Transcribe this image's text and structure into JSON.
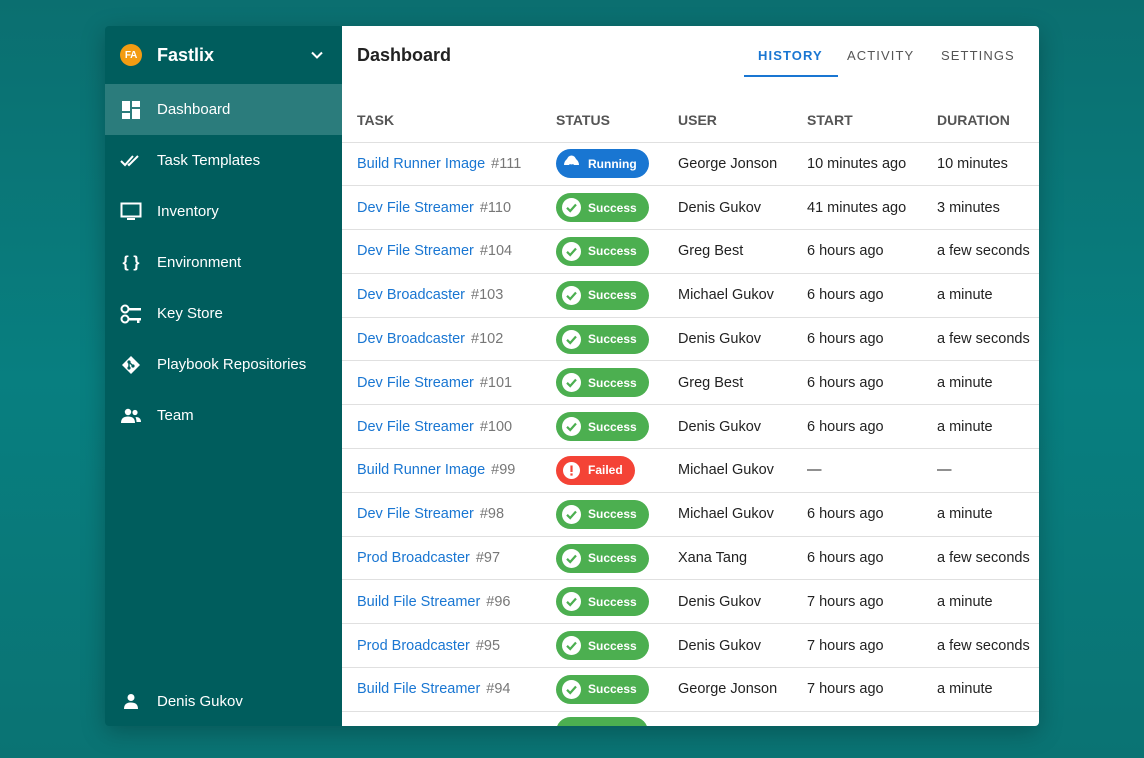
{
  "brand": {
    "initials": "FA",
    "name": "Fastlix"
  },
  "sidebar": {
    "items": [
      {
        "label": "Dashboard",
        "icon": "dashboard-icon",
        "active": true
      },
      {
        "label": "Task Templates",
        "icon": "done-all-icon"
      },
      {
        "label": "Inventory",
        "icon": "monitor-icon"
      },
      {
        "label": "Environment",
        "icon": "braces-icon"
      },
      {
        "label": "Key Store",
        "icon": "key-icon"
      },
      {
        "label": "Playbook Repositories",
        "icon": "git-icon"
      },
      {
        "label": "Team",
        "icon": "team-icon"
      }
    ],
    "user": "Denis Gukov"
  },
  "header": {
    "title": "Dashboard",
    "tabs": [
      "HISTORY",
      "ACTIVITY",
      "SETTINGS"
    ],
    "active_tab": "HISTORY"
  },
  "table": {
    "columns": [
      "TASK",
      "STATUS",
      "USER",
      "START",
      "DURATION"
    ],
    "rows": [
      {
        "task": "Build Runner Image",
        "num": "#111",
        "status": "Running",
        "user": "George Jonson",
        "start": "10 minutes ago",
        "duration": "10 minutes"
      },
      {
        "task": "Dev File Streamer",
        "num": "#110",
        "status": "Success",
        "user": "Denis Gukov",
        "start": "41 minutes ago",
        "duration": "3 minutes"
      },
      {
        "task": "Dev File Streamer",
        "num": "#104",
        "status": "Success",
        "user": "Greg Best",
        "start": "6 hours ago",
        "duration": "a few seconds"
      },
      {
        "task": "Dev Broadcaster",
        "num": "#103",
        "status": "Success",
        "user": "Michael Gukov",
        "start": "6 hours ago",
        "duration": "a minute"
      },
      {
        "task": "Dev Broadcaster",
        "num": "#102",
        "status": "Success",
        "user": "Denis Gukov",
        "start": "6 hours ago",
        "duration": "a few seconds"
      },
      {
        "task": "Dev File Streamer",
        "num": "#101",
        "status": "Success",
        "user": "Greg Best",
        "start": "6 hours ago",
        "duration": "a minute"
      },
      {
        "task": "Dev File Streamer",
        "num": "#100",
        "status": "Success",
        "user": "Denis Gukov",
        "start": "6 hours ago",
        "duration": "a minute"
      },
      {
        "task": "Build Runner Image",
        "num": "#99",
        "status": "Failed",
        "user": "Michael Gukov",
        "start": "—",
        "duration": "—"
      },
      {
        "task": "Dev File Streamer",
        "num": "#98",
        "status": "Success",
        "user": "Michael Gukov",
        "start": "6 hours ago",
        "duration": "a minute"
      },
      {
        "task": "Prod Broadcaster",
        "num": "#97",
        "status": "Success",
        "user": "Xana Tang",
        "start": "6 hours ago",
        "duration": "a few seconds"
      },
      {
        "task": "Build File Streamer",
        "num": "#96",
        "status": "Success",
        "user": "Denis Gukov",
        "start": "7 hours ago",
        "duration": "a minute"
      },
      {
        "task": "Prod Broadcaster",
        "num": "#95",
        "status": "Success",
        "user": "Denis Gukov",
        "start": "7 hours ago",
        "duration": "a few seconds"
      },
      {
        "task": "Build File Streamer",
        "num": "#94",
        "status": "Success",
        "user": "George Jonson",
        "start": "7 hours ago",
        "duration": "a minute"
      }
    ]
  },
  "colors": {
    "background": "#087f80",
    "sidebar": "#005d5d",
    "sidebar_active": "#2b7c7c",
    "accent": "#1976d2",
    "success": "#4caf50",
    "failed": "#f44336",
    "brand_avatar": "#f39c12"
  }
}
